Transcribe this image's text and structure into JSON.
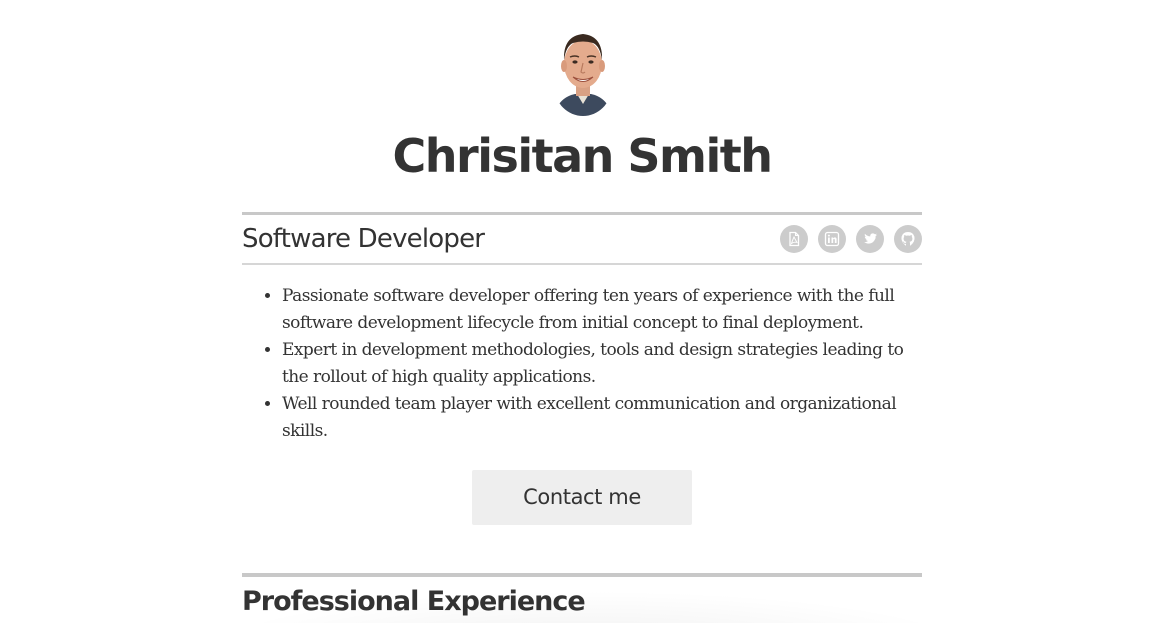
{
  "profile": {
    "name": "Chrisitan Smith",
    "role": "Software Developer",
    "avatar_icon": "person-photo-icon"
  },
  "social": [
    {
      "icon": "pdf-icon",
      "label": "PDF"
    },
    {
      "icon": "linkedin-icon",
      "label": "LinkedIn"
    },
    {
      "icon": "twitter-icon",
      "label": "Twitter"
    },
    {
      "icon": "github-icon",
      "label": "GitHub"
    }
  ],
  "summary": [
    "Passionate software developer offering ten years of experience with the full software development lifecycle from initial concept to final deployment.",
    "Expert in development methodologies, tools and design strategies leading to the rollout of high quality applications.",
    "Well rounded team player with excellent communication and organizational skills."
  ],
  "contact": {
    "label": "Contact me"
  },
  "sections": {
    "experience_title": "Professional Experience"
  },
  "colors": {
    "text": "#333333",
    "rule": "#c8c8c8",
    "icon_bg": "#cccccc",
    "button_bg": "#eeeeee",
    "background": "#ffffff"
  }
}
